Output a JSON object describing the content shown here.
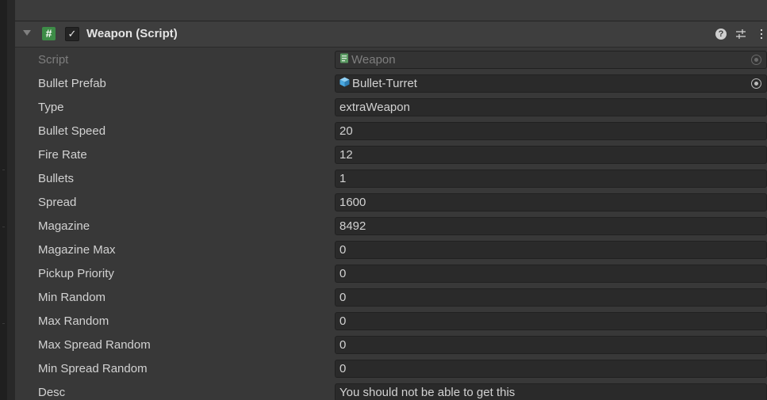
{
  "component": {
    "title": "Weapon (Script)",
    "enabled_glyph": "✓",
    "script_icon_glyph": "#",
    "help_glyph": "?",
    "icons": [
      "foldout-arrow-icon",
      "script-icon",
      "help-icon",
      "preset-icon",
      "context-menu-icon"
    ]
  },
  "fields": [
    {
      "label": "Script",
      "value": "Weapon",
      "disabled": true,
      "object_icon": "script-asset-icon",
      "picker": true
    },
    {
      "label": "Bullet Prefab",
      "value": "Bullet-Turret",
      "disabled": false,
      "object_icon": "prefab-icon",
      "picker": true
    },
    {
      "label": "Type",
      "value": "extraWeapon"
    },
    {
      "label": "Bullet Speed",
      "value": "20"
    },
    {
      "label": "Fire Rate",
      "value": "12"
    },
    {
      "label": "Bullets",
      "value": "1"
    },
    {
      "label": "Spread",
      "value": "1600"
    },
    {
      "label": "Magazine",
      "value": "8492"
    },
    {
      "label": "Magazine Max",
      "value": "0"
    },
    {
      "label": "Pickup Priority",
      "value": "0"
    },
    {
      "label": "Min Random",
      "value": "0"
    },
    {
      "label": "Max Random",
      "value": "0"
    },
    {
      "label": "Max Spread Random",
      "value": "0"
    },
    {
      "label": "Min Spread Random",
      "value": "0"
    },
    {
      "label": "Desc",
      "value": "You should not be able to get this"
    }
  ],
  "colors": {
    "script_icon": "#3d8c47",
    "prefab_icon": "#4aa8e0",
    "script_asset_icon": "#5a9a62"
  }
}
